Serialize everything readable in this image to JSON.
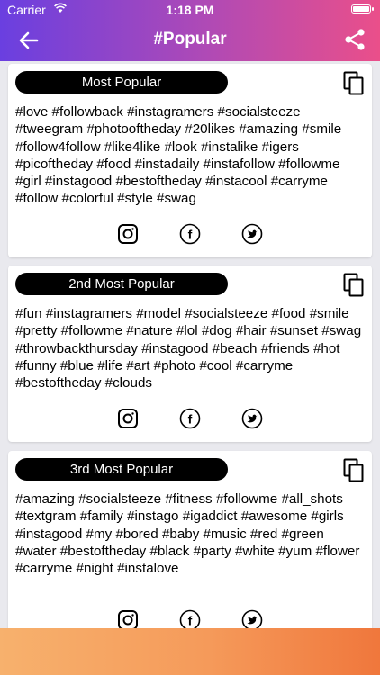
{
  "status_bar": {
    "carrier": "Carrier",
    "time": "1:18 PM"
  },
  "nav": {
    "title": "#Popular"
  },
  "cards": [
    {
      "title": "Most Popular",
      "tags": "#love #followback #instagramers #socialsteeze #tweegram #photooftheday #20likes #amazing #smile #follow4follow #like4like #look #instalike #igers #picoftheday #food #instadaily #instafollow #followme #girl #instagood #bestoftheday #instacool #carryme #follow #colorful #style #swag"
    },
    {
      "title": "2nd Most Popular",
      "tags": "#fun #instagramers #model #socialsteeze #food #smile #pretty #followme #nature #lol #dog #hair #sunset #swag #throwbackthursday #instagood #beach #friends #hot #funny #blue #life #art #photo #cool #carryme #bestoftheday #clouds"
    },
    {
      "title": "3rd Most Popular",
      "tags": "#amazing #socialsteeze #fitness #followme #all_shots #textgram #family #instago #igaddict #awesome #girls #instagood #my #bored #baby #music #red #green #water #bestoftheday #black #party #white #yum #flower #carryme #night #instalove"
    }
  ],
  "icons": {
    "back": "arrow-left-icon",
    "share": "share-icon",
    "copy": "copy-icon",
    "instagram": "instagram-icon",
    "facebook": "facebook-icon",
    "twitter": "twitter-icon"
  },
  "colors": {
    "header_start": "#6a3fe0",
    "header_end": "#ea4f8a",
    "footer_start": "#f7b16d",
    "footer_end": "#f0773c",
    "pill": "#000000"
  }
}
